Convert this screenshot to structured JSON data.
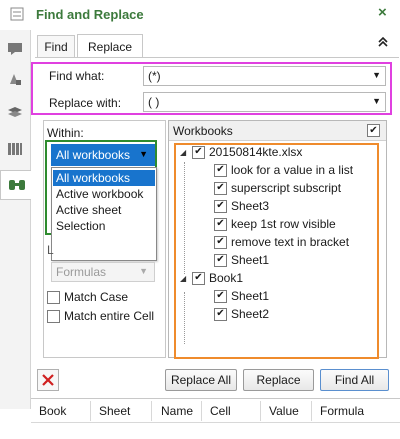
{
  "window": {
    "title": "Find and Replace",
    "close_icon": "×"
  },
  "tabs": [
    {
      "label": "Find"
    },
    {
      "label": "Replace"
    }
  ],
  "find": {
    "label": "Find what:",
    "value": "(*)"
  },
  "replace": {
    "label": "Replace with:",
    "value": "( )"
  },
  "within": {
    "label": "Within:",
    "selected": "All workbooks",
    "options": [
      "All workbooks",
      "Active workbook",
      "Active sheet",
      "Selection"
    ],
    "partial_label": "L",
    "lookin_value": "Formulas"
  },
  "options": {
    "match_case": "Match Case",
    "match_entire": "Match entire Cell"
  },
  "workbooks": {
    "title": "Workbooks",
    "tree": [
      {
        "name": "20150814kte.xlsx",
        "sheets": [
          "look for a value in a list",
          "superscript subscript",
          "Sheet3",
          "keep 1st row visible",
          "remove text in bracket",
          "Sheet1"
        ]
      },
      {
        "name": "Book1",
        "sheets": [
          "Sheet1",
          "Sheet2"
        ]
      }
    ]
  },
  "buttons": {
    "replace_all": "Replace All",
    "replace": "Replace",
    "find_all": "Find All"
  },
  "results": {
    "columns": [
      "Book",
      "Sheet",
      "Name",
      "Cell",
      "Value",
      "Formula"
    ]
  },
  "colors": {
    "accent": "#3c7a3c",
    "find_box": "#e040e0",
    "within_box": "#2e8b2e",
    "workbooks_box": "#ef8b2c",
    "select_blue": "#1874cd"
  }
}
